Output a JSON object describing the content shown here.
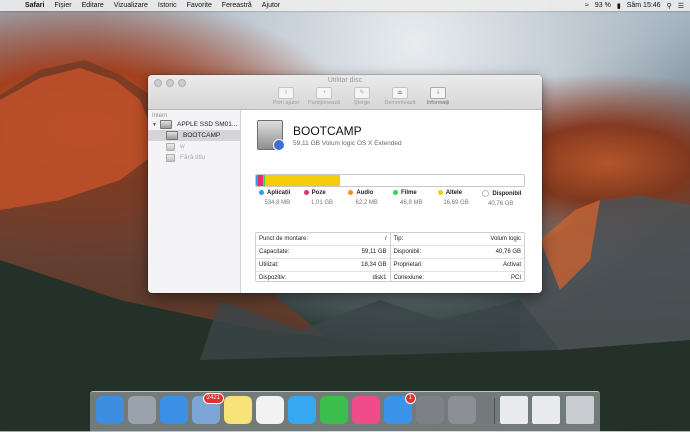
{
  "menubar": {
    "app": "Safari",
    "menus": [
      "Fișier",
      "Editare",
      "Vizualizare",
      "Istoric",
      "Favorite",
      "Fereastră",
      "Ajutor"
    ],
    "battery": "93 %",
    "clock": "Sâm 15:46"
  },
  "window": {
    "title": "Utilitar disc",
    "toolbar": [
      {
        "label": "Prim ajutor",
        "icon": "first-aid-icon"
      },
      {
        "label": "Partiționează",
        "icon": "partition-icon"
      },
      {
        "label": "Șterge",
        "icon": "erase-icon"
      },
      {
        "label": "Demontează",
        "icon": "unmount-icon"
      },
      {
        "label": "Informații",
        "icon": "info-icon"
      }
    ]
  },
  "sidebar": {
    "section": "Intern",
    "disk": "APPLE SSD SM01...",
    "selected_volume": "BOOTCAMP",
    "other_volumes": [
      "w",
      "Fără titlu"
    ]
  },
  "volume": {
    "name": "BOOTCAMP",
    "subtitle": "59,11 GB Volum logic OS X Extended"
  },
  "usage": {
    "categories": [
      {
        "name": "Aplicații",
        "size": "534,8 MB",
        "color": "#2e9fe6",
        "share": 0.009
      },
      {
        "name": "Poze",
        "size": "1,01 GB",
        "color": "#e8306e",
        "share": 0.017
      },
      {
        "name": "Audio",
        "size": "62,2 MB",
        "color": "#ff8e1f",
        "share": 0.002
      },
      {
        "name": "Filme",
        "size": "46,8 MB",
        "color": "#3ad24a",
        "share": 0.001
      },
      {
        "name": "Altele",
        "size": "16,69 GB",
        "color": "#f5cc0a",
        "share": 0.282
      },
      {
        "name": "Disponibil",
        "size": "40,76 GB",
        "color": "#ffffff",
        "share": 0.689
      }
    ]
  },
  "info": {
    "left": [
      {
        "label": "Punct de montare:",
        "value": "/"
      },
      {
        "label": "Capacitate:",
        "value": "59,11 GB"
      },
      {
        "label": "Utilizat:",
        "value": "18,34 GB"
      },
      {
        "label": "Dispozitiv:",
        "value": "disk1"
      }
    ],
    "right": [
      {
        "label": "Tip:",
        "value": "Volum logic"
      },
      {
        "label": "Disponibil:",
        "value": "40,76 GB"
      },
      {
        "label": "Proprietari:",
        "value": "Activat"
      },
      {
        "label": "Conexiune:",
        "value": "PCI"
      }
    ]
  },
  "dock": {
    "apps": [
      {
        "name": "finder-icon",
        "color": "#3d8de0"
      },
      {
        "name": "launchpad-icon",
        "color": "#9aa3ad"
      },
      {
        "name": "safari-icon",
        "color": "#3b8fe5"
      },
      {
        "name": "mail-icon",
        "color": "#7da6d6",
        "badge": "2421"
      },
      {
        "name": "notes-icon",
        "color": "#f7e27a"
      },
      {
        "name": "photos-icon",
        "color": "#f2f2f2"
      },
      {
        "name": "messages-icon",
        "color": "#36a7f1"
      },
      {
        "name": "facetime-icon",
        "color": "#3bbe4b"
      },
      {
        "name": "itunes-icon",
        "color": "#f04c8a"
      },
      {
        "name": "app-store-icon",
        "color": "#3a93e8",
        "badge": "1"
      },
      {
        "name": "system-preferences-icon",
        "color": "#7d8187"
      },
      {
        "name": "disk-utility-icon",
        "color": "#8c9096"
      },
      {
        "name": "window-thumbnail-1",
        "color": "#e9eaec"
      },
      {
        "name": "window-thumbnail-2",
        "color": "#e9eaec"
      },
      {
        "name": "trash-icon",
        "color": "#c9cdd2"
      }
    ]
  }
}
